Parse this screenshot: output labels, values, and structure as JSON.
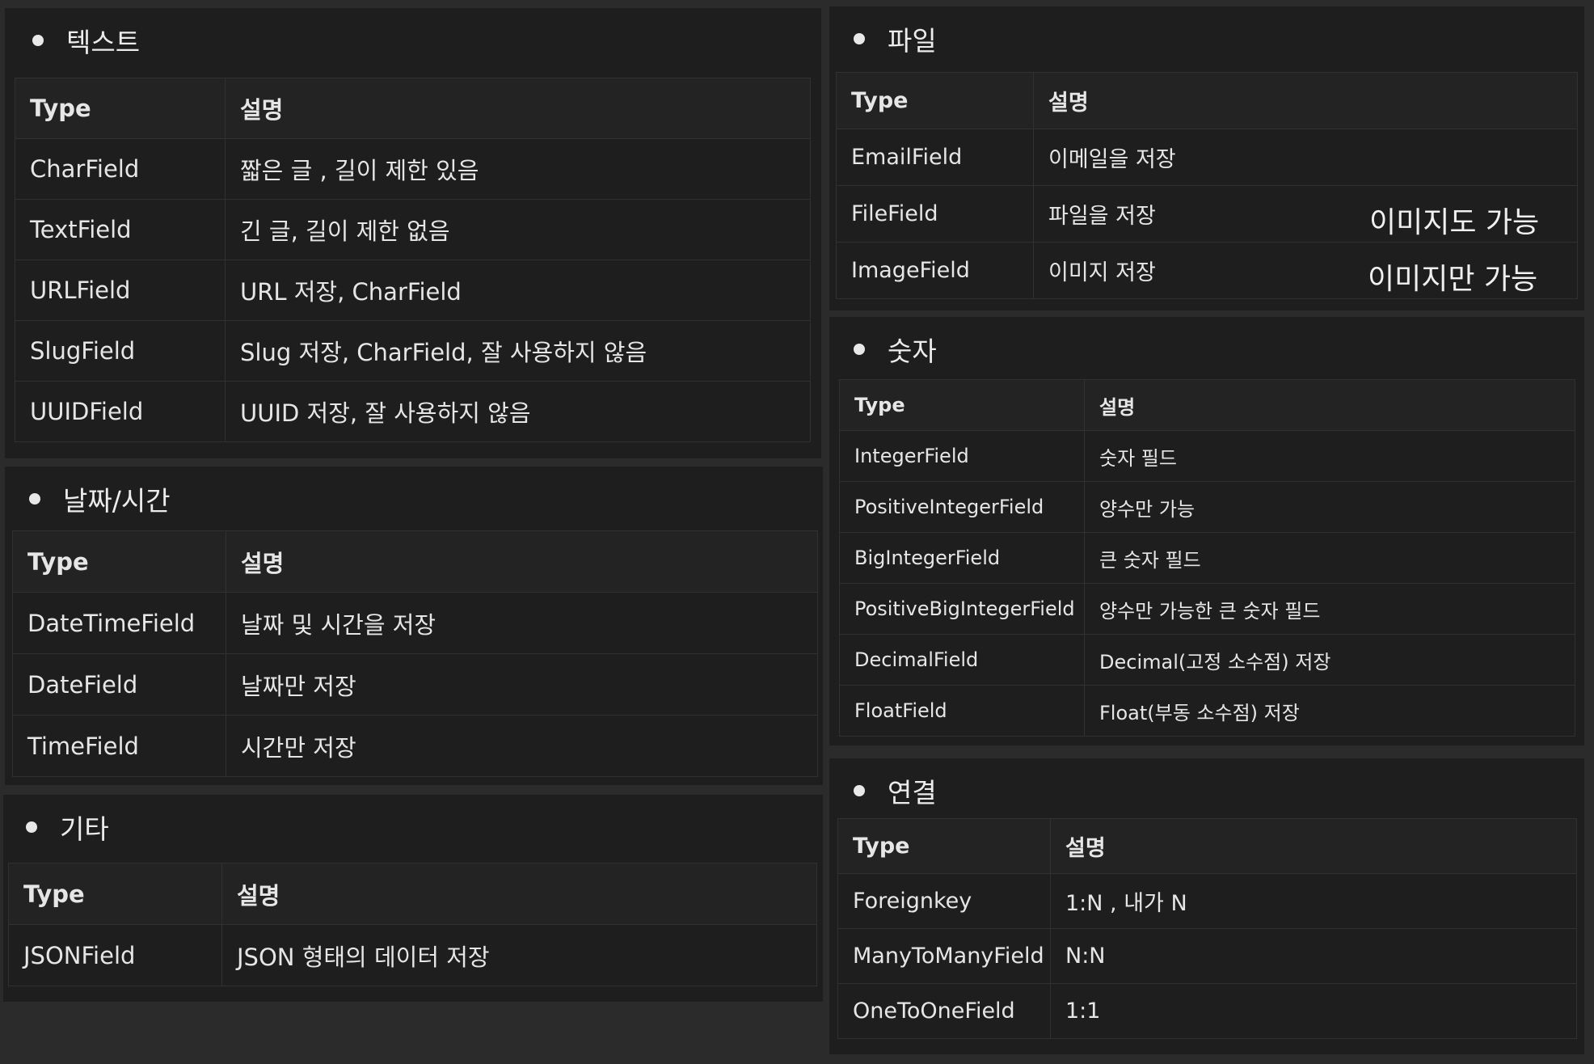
{
  "sections": {
    "text": {
      "title": "텍스트",
      "header": [
        "Type",
        "설명"
      ],
      "rows": [
        [
          "CharField",
          "짧은 글 , 길이 제한 있음"
        ],
        [
          "TextField",
          "긴 글, 길이 제한 없음"
        ],
        [
          "URLField",
          "URL 저장, CharField"
        ],
        [
          "SlugField",
          "Slug 저장, CharField, 잘 사용하지 않음"
        ],
        [
          "UUIDField",
          "UUID 저장, 잘 사용하지 않음"
        ]
      ]
    },
    "datetime": {
      "title": "날짜/시간",
      "header": [
        "Type",
        "설명"
      ],
      "rows": [
        [
          "DateTimeField",
          "날짜 및 시간을 저장"
        ],
        [
          "DateField",
          "날짜만 저장"
        ],
        [
          "TimeField",
          "시간만 저장"
        ]
      ]
    },
    "etc": {
      "title": "기타",
      "header": [
        "Type",
        "설명"
      ],
      "rows": [
        [
          "JSONField",
          "JSON 형태의 데이터 저장"
        ]
      ]
    },
    "file": {
      "title": "파일",
      "header": [
        "Type",
        "설명"
      ],
      "rows": [
        [
          "EmailField",
          "이메일을 저장"
        ],
        [
          "FileField",
          "파일을 저장"
        ],
        [
          "ImageField",
          "이미지 저장"
        ]
      ],
      "notes": [
        "이미지도 가능",
        "이미지만 가능"
      ]
    },
    "number": {
      "title": "숫자",
      "header": [
        "Type",
        "설명"
      ],
      "rows": [
        [
          "IntegerField",
          "숫자 필드"
        ],
        [
          "PositiveIntegerField",
          "양수만 가능"
        ],
        [
          "BigIntegerField",
          "큰 숫자 필드"
        ],
        [
          "PositiveBigIntegerField",
          "양수만 가능한 큰 숫자 필드"
        ],
        [
          "DecimalField",
          "Decimal(고정 소수점) 저장"
        ],
        [
          "FloatField",
          "Float(부동 소수점) 저장"
        ]
      ]
    },
    "relation": {
      "title": "연결",
      "header": [
        "Type",
        "설명"
      ],
      "rows": [
        [
          "Foreignkey",
          "1:N , 내가 N"
        ],
        [
          "ManyToManyField",
          "N:N"
        ],
        [
          "OneToOneField",
          "1:1"
        ]
      ]
    }
  },
  "icons": {
    "bullet": "bullet-dot-icon"
  },
  "colors": {
    "background": "#2b2b2c",
    "panel": "#1e1e1f",
    "header_row": "#232324",
    "border": "#313133",
    "text": "#e6e6e6"
  }
}
